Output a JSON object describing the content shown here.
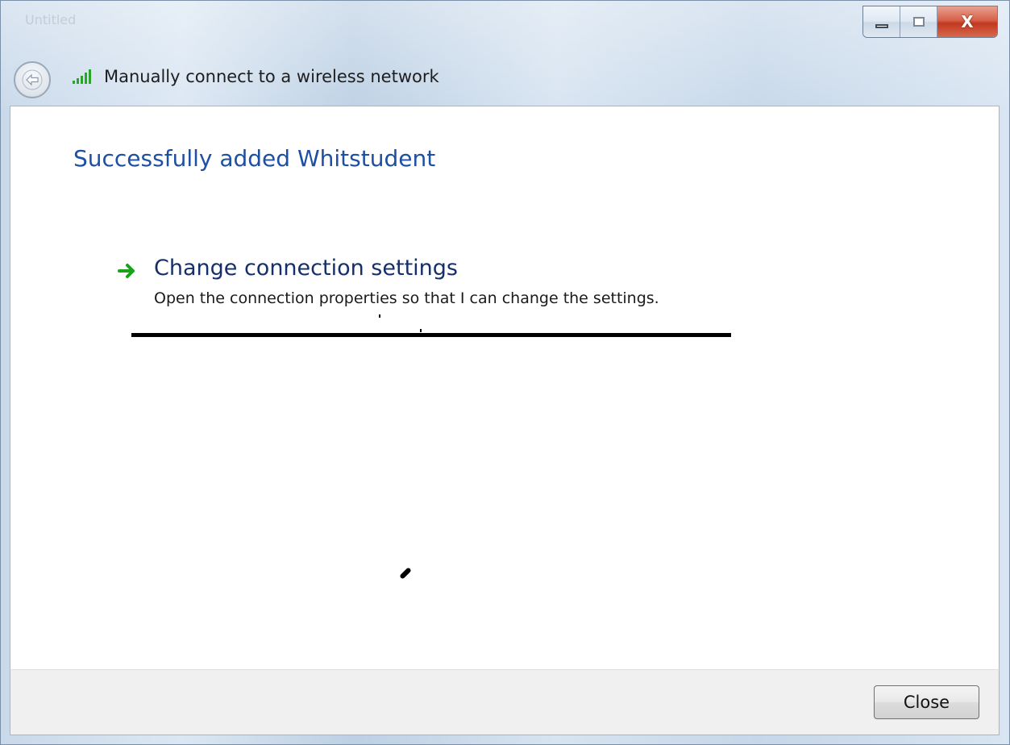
{
  "window": {
    "title": "Manually connect to a wireless network",
    "faded_title": "Untitled",
    "faded_search": "",
    "caption": {
      "close_label": "X"
    }
  },
  "content": {
    "heading": "Successfully added Whitstudent",
    "option": {
      "title": "Change connection settings",
      "description": "Open the connection properties so that I can change the settings."
    }
  },
  "footer": {
    "close_label": "Close"
  },
  "colors": {
    "heading": "#1d50a2",
    "link_title": "#152f6a",
    "arrow": "#1aa31a",
    "signal": "#2aa52a"
  },
  "icons": {
    "back": "back-arrow-icon",
    "signal": "wireless-signal-icon",
    "option": "green-arrow-icon"
  }
}
